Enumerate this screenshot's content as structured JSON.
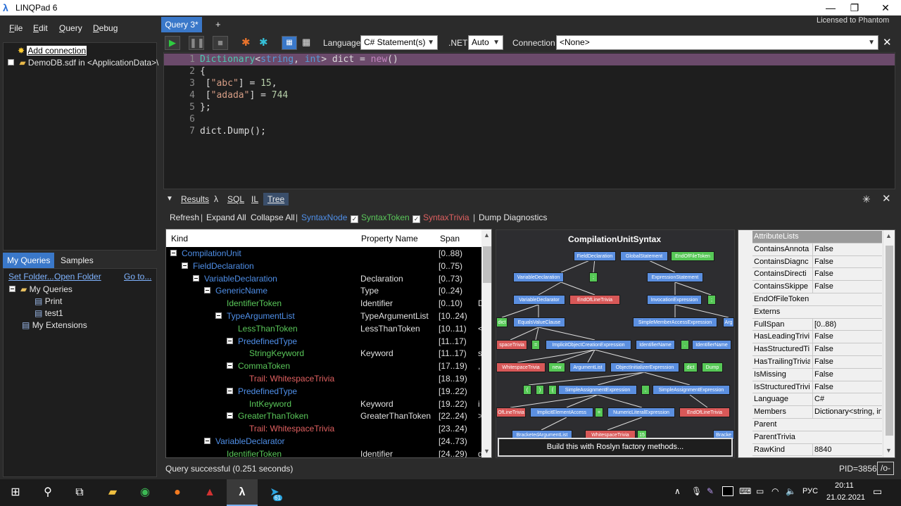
{
  "window": {
    "title": "LINQPad 6",
    "license": "Licensed to Phantom"
  },
  "menu": [
    {
      "label": "File",
      "u": "F",
      "rest": "ile"
    },
    {
      "label": "Edit",
      "u": "E",
      "rest": "dit"
    },
    {
      "label": "Query",
      "u": "Q",
      "rest": "uery"
    },
    {
      "label": "Debug",
      "u": "D",
      "rest": "ebug"
    }
  ],
  "connections": {
    "add": "Add connection",
    "db": "DemoDB.sdf in <ApplicationData>\\"
  },
  "left_tabs": {
    "my_queries": "My Queries",
    "samples": "Samples"
  },
  "queries_links": {
    "set_folder": "Set Folder...",
    "open_folder": "Open Folder",
    "goto": "Go to..."
  },
  "queries_tree": {
    "root": "My Queries",
    "q1": "Print",
    "q2": "test1",
    "ext": "My Extensions"
  },
  "query_tab": {
    "label": "Query 3*",
    "add": "+"
  },
  "toolbar": {
    "language_label": "Language",
    "language_value": "C# Statement(s)",
    "net_label": ".NET",
    "net_value": "Auto",
    "connection_label": "Connection",
    "connection_value": "<None>"
  },
  "editor": {
    "line_numbers": [
      "1",
      "2",
      "3",
      "4",
      "5",
      "6",
      "7"
    ]
  },
  "results_tabs": {
    "results": "Results",
    "lambda": "λ",
    "sql": "SQL",
    "il": "IL",
    "tree": "Tree"
  },
  "tree_toolbar": {
    "refresh": "Refresh",
    "expand": "Expand All",
    "collapse": "Collapse All",
    "syntax_node": "SyntaxNode",
    "syntax_token": "SyntaxToken",
    "syntax_trivia": "SyntaxTrivia",
    "dump": "Dump Diagnostics"
  },
  "grid": {
    "headers": {
      "kind": "Kind",
      "prop": "Property Name",
      "span": "Span"
    },
    "rows": [
      {
        "kind": "CompilationUnit",
        "prop": "",
        "span": "[0..88)",
        "extra": "",
        "indent": 0,
        "color": "n-blue",
        "toggle": true
      },
      {
        "kind": "FieldDeclaration",
        "prop": "",
        "span": "[0..75)",
        "extra": "",
        "indent": 1,
        "color": "n-blue",
        "toggle": true
      },
      {
        "kind": "VariableDeclaration",
        "prop": "Declaration",
        "span": "[0..73)",
        "extra": "",
        "indent": 2,
        "color": "n-blue",
        "toggle": true
      },
      {
        "kind": "GenericName",
        "prop": "Type",
        "span": "[0..24)",
        "extra": "",
        "indent": 3,
        "color": "n-blue",
        "toggle": true
      },
      {
        "kind": "IdentifierToken",
        "prop": "Identifier",
        "span": "[0..10)",
        "extra": "D",
        "indent": 4,
        "color": "n-green",
        "toggle": false
      },
      {
        "kind": "TypeArgumentList",
        "prop": "TypeArgumentList",
        "span": "[10..24)",
        "extra": "",
        "indent": 4,
        "color": "n-blue",
        "toggle": true
      },
      {
        "kind": "LessThanToken",
        "prop": "LessThanToken",
        "span": "[10..11)",
        "extra": "<",
        "indent": 5,
        "color": "n-green",
        "toggle": false
      },
      {
        "kind": "PredefinedType",
        "prop": "",
        "span": "[11..17)",
        "extra": "",
        "indent": 5,
        "color": "n-blue",
        "toggle": true
      },
      {
        "kind": "StringKeyword",
        "prop": "Keyword",
        "span": "[11..17)",
        "extra": "s",
        "indent": 6,
        "color": "n-green",
        "toggle": false
      },
      {
        "kind": "CommaToken",
        "prop": "",
        "span": "[17..19)",
        "extra": ",",
        "indent": 5,
        "color": "n-green",
        "toggle": true
      },
      {
        "kind": "Trail: WhitespaceTrivia",
        "prop": "",
        "span": "[18..19)",
        "extra": "",
        "indent": 6,
        "color": "n-red",
        "toggle": false
      },
      {
        "kind": "PredefinedType",
        "prop": "",
        "span": "[19..22)",
        "extra": "",
        "indent": 5,
        "color": "n-blue",
        "toggle": true
      },
      {
        "kind": "IntKeyword",
        "prop": "Keyword",
        "span": "[19..22)",
        "extra": "i",
        "indent": 6,
        "color": "n-green",
        "toggle": false
      },
      {
        "kind": "GreaterThanToken",
        "prop": "GreaterThanToken",
        "span": "[22..24)",
        "extra": ">",
        "indent": 5,
        "color": "n-green",
        "toggle": true
      },
      {
        "kind": "Trail: WhitespaceTrivia",
        "prop": "",
        "span": "[23..24)",
        "extra": "",
        "indent": 6,
        "color": "n-red",
        "toggle": false
      },
      {
        "kind": "VariableDeclarator",
        "prop": "",
        "span": "[24..73)",
        "extra": "",
        "indent": 3,
        "color": "n-blue",
        "toggle": true
      },
      {
        "kind": "IdentifierToken",
        "prop": "Identifier",
        "span": "[24..29)",
        "extra": "d",
        "indent": 4,
        "color": "n-green",
        "toggle": false
      }
    ]
  },
  "graph": {
    "title": "CompilationUnitSyntax",
    "build": "Build this with Roslyn factory methods...",
    "nodes": [
      {
        "t": "FieldDeclaration",
        "c": "gb"
      },
      {
        "t": "GlobalStatement",
        "c": "gb"
      },
      {
        "t": "EndOfFileToken",
        "c": "gg"
      },
      {
        "t": "VariableDeclaration",
        "c": "gb"
      },
      {
        "t": ";",
        "c": "gg"
      },
      {
        "t": "ExpressionStatement",
        "c": "gb"
      },
      {
        "t": "VariableDeclarator",
        "c": "gb"
      },
      {
        "t": "EndOfLineTrivia",
        "c": "gr"
      },
      {
        "t": "InvocationExpression",
        "c": "gb"
      },
      {
        "t": ";",
        "c": "gg"
      },
      {
        "t": "dict",
        "c": "gg"
      },
      {
        "t": "EqualsValueClause",
        "c": "gb"
      },
      {
        "t": "SimpleMemberAccessExpression",
        "c": "gb"
      },
      {
        "t": "Arg",
        "c": "gb"
      },
      {
        "t": "spaceTrivia",
        "c": "gr"
      },
      {
        "t": "=",
        "c": "gg"
      },
      {
        "t": "ImplicitObjectCreationExpression",
        "c": "gb"
      },
      {
        "t": "IdentifierName",
        "c": "gb"
      },
      {
        "t": ".",
        "c": "gg"
      },
      {
        "t": "IdentifierName",
        "c": "gb"
      },
      {
        "t": "WhitespaceTrivia",
        "c": "gr"
      },
      {
        "t": "new",
        "c": "gg"
      },
      {
        "t": "ArgumentList",
        "c": "gb"
      },
      {
        "t": "ObjectInitializerExpression",
        "c": "gb"
      },
      {
        "t": "dict",
        "c": "gg"
      },
      {
        "t": "Dump",
        "c": "gg"
      },
      {
        "t": "(",
        "c": "gg"
      },
      {
        "t": ")",
        "c": "gg"
      },
      {
        "t": "{",
        "c": "gg"
      },
      {
        "t": "SimpleAssignmentExpression",
        "c": "gb"
      },
      {
        "t": ",",
        "c": "gg"
      },
      {
        "t": "SimpleAssignmentExpression",
        "c": "gb"
      },
      {
        "t": "OfLineTrivia",
        "c": "gr"
      },
      {
        "t": "ImplicitElementAccess",
        "c": "gb"
      },
      {
        "t": "=",
        "c": "gg"
      },
      {
        "t": "NumericLiteralExpression",
        "c": "gb"
      },
      {
        "t": "EndOfLineTrivia",
        "c": "gr"
      },
      {
        "t": "BracketedArgumentList",
        "c": "gb"
      },
      {
        "t": "WhitespaceTrivia",
        "c": "gr"
      },
      {
        "t": "15",
        "c": "gg"
      },
      {
        "t": "Bracke",
        "c": "gb"
      }
    ]
  },
  "props": [
    {
      "k": "AttributeLists",
      "v": ""
    },
    {
      "k": "ContainsAnnota",
      "v": "False"
    },
    {
      "k": "ContainsDiagnc",
      "v": "False"
    },
    {
      "k": "ContainsDirecti",
      "v": "False"
    },
    {
      "k": "ContainsSkippe",
      "v": "False"
    },
    {
      "k": "EndOfFileToken",
      "v": ""
    },
    {
      "k": "Externs",
      "v": ""
    },
    {
      "k": "FullSpan",
      "v": "[0..88)"
    },
    {
      "k": "HasLeadingTrivi",
      "v": "False"
    },
    {
      "k": "HasStructuredTi",
      "v": "False"
    },
    {
      "k": "HasTrailingTrivia",
      "v": "False"
    },
    {
      "k": "IsMissing",
      "v": "False"
    },
    {
      "k": "IsStructuredTrivi",
      "v": "False"
    },
    {
      "k": "Language",
      "v": "C#"
    },
    {
      "k": "Members",
      "v": "Dictionary<string, in"
    },
    {
      "k": "Parent",
      "v": ""
    },
    {
      "k": "ParentTrivia",
      "v": ""
    },
    {
      "k": "RawKind",
      "v": "8840"
    }
  ],
  "status": {
    "text": "Query successful  (0.251 seconds)",
    "pid": "PID=3856",
    "mode": "/o-"
  },
  "taskbar": {
    "lang": "РУС",
    "time": "20:11",
    "date": "21.02.2021",
    "badge": "61"
  },
  "colors": {
    "accent": "#3a78c9",
    "node_blue": "#4f8fe8",
    "token_green": "#5ac85a",
    "trivia_red": "#e06060",
    "selected_line": "#6b4a6b"
  }
}
